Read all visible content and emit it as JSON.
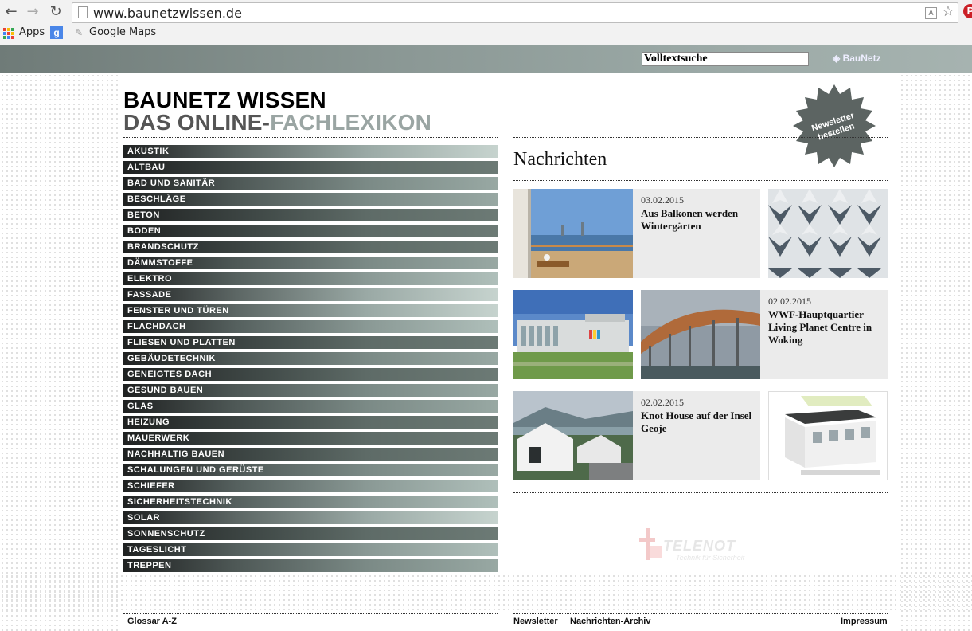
{
  "browser": {
    "url": "www.baunetzwissen.de",
    "bookmarks": {
      "apps": "Apps",
      "google_maps": "Google Maps"
    }
  },
  "header": {
    "search_value": "Volltextsuche",
    "logo_text": "BauNetz"
  },
  "site": {
    "title_line1": "BAUNETZ WISSEN",
    "title_line2_a": "DAS ONLINE-",
    "title_line2_b": "FACHLEXIKON"
  },
  "sidebar": {
    "items": [
      {
        "label": "AKUSTIK"
      },
      {
        "label": "ALTBAU"
      },
      {
        "label": "BAD UND SANITÄR"
      },
      {
        "label": "BESCHLÄGE"
      },
      {
        "label": "BETON"
      },
      {
        "label": "BODEN"
      },
      {
        "label": "BRANDSCHUTZ"
      },
      {
        "label": "DÄMMSTOFFE"
      },
      {
        "label": "ELEKTRO"
      },
      {
        "label": "FASSADE"
      },
      {
        "label": "FENSTER UND TÜREN"
      },
      {
        "label": "FLACHDACH"
      },
      {
        "label": "FLIESEN UND PLATTEN"
      },
      {
        "label": "GEBÄUDETECHNIK"
      },
      {
        "label": "GENEIGTES DACH"
      },
      {
        "label": "GESUND BAUEN"
      },
      {
        "label": "GLAS"
      },
      {
        "label": "HEIZUNG"
      },
      {
        "label": "MAUERWERK"
      },
      {
        "label": "NACHHALTIG BAUEN"
      },
      {
        "label": "SCHALUNGEN UND GERÜSTE"
      },
      {
        "label": "SCHIEFER"
      },
      {
        "label": "SICHERHEITSTECHNIK"
      },
      {
        "label": "SOLAR"
      },
      {
        "label": "SONNENSCHUTZ"
      },
      {
        "label": "TAGESLICHT"
      },
      {
        "label": "TREPPEN"
      }
    ]
  },
  "news": {
    "heading": "Nachrichten",
    "badge_line1": "Newsletter",
    "badge_line2": "bestellen",
    "items": [
      {
        "date": "03.02.2015",
        "headline": "Aus Balkonen werden Wintergärten"
      },
      {
        "date": "02.02.2015",
        "headline": "WWF-Hauptquartier Living Planet Centre in Woking"
      },
      {
        "date": "02.02.2015",
        "headline": "Knot House auf der Insel Geoje"
      }
    ]
  },
  "ad": {
    "name": "TELENOT",
    "tagline": "Technik für Sicherheit"
  },
  "footer": {
    "glossar": "Glossar A-Z",
    "newsletter": "Newsletter",
    "archiv": "Nachrichten-Archiv",
    "impressum": "Impressum"
  },
  "colors": {
    "accent": "#8a9794",
    "badge": "#5c6462"
  }
}
